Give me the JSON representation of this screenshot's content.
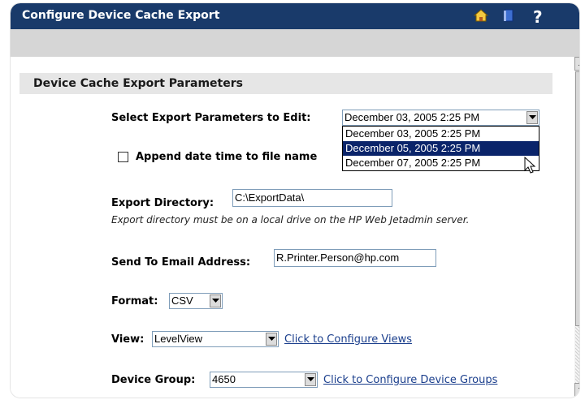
{
  "window": {
    "title": "Configure Device Cache Export",
    "icons": [
      "home-icon",
      "book-icon",
      "help-icon"
    ]
  },
  "section": {
    "title": "Device Cache Export Parameters"
  },
  "export_params": {
    "label": "Select Export Parameters to Edit:",
    "selected": "December 03, 2005 2:25 PM",
    "options": [
      "December 03, 2005 2:25 PM",
      "December 05, 2005 2:25 PM",
      "December 07, 2005 2:25 PM"
    ],
    "highlighted_index": 1
  },
  "append_datetime": {
    "label": "Append date time to file name",
    "checked": false
  },
  "export_directory": {
    "label": "Export Directory:",
    "value": "C:\\ExportData\\",
    "note": "Export directory must be on a local drive on the HP Web Jetadmin server."
  },
  "email": {
    "label": "Send To Email Address:",
    "value": "R.Printer.Person@hp.com"
  },
  "format": {
    "label": "Format:",
    "value": "CSV"
  },
  "view": {
    "label": "View:",
    "value": "LevelView",
    "link": "Click to Configure Views"
  },
  "device_group": {
    "label": "Device Group:",
    "value": "4650",
    "link": "Click to Configure Device Groups"
  },
  "colors": {
    "titlebar": "#193a6a",
    "highlight": "#0a246a",
    "link": "#1a3e8c"
  }
}
